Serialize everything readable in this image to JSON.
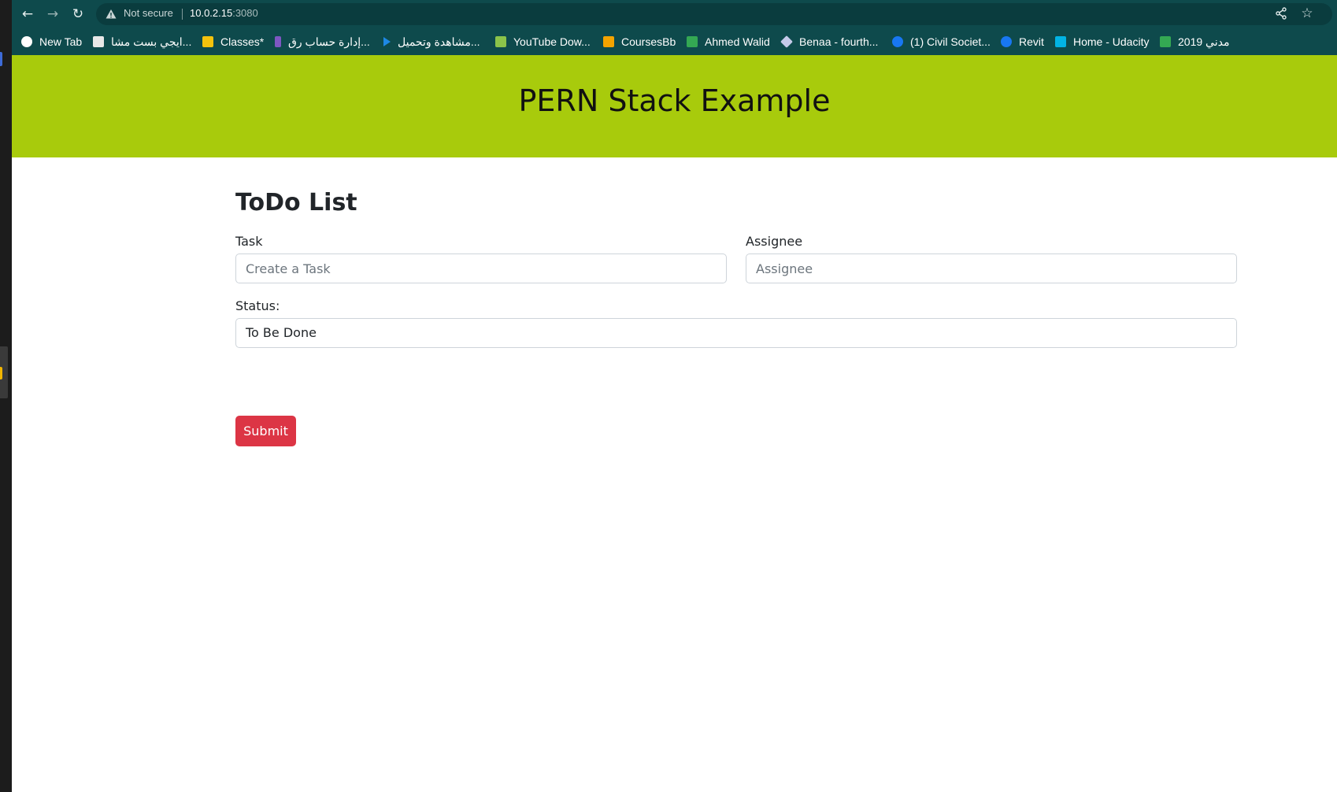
{
  "browser": {
    "security_label": "Not secure",
    "url_host": "10.0.2.15",
    "url_port": ":3080",
    "back_icon": "arrow-left-icon",
    "forward_icon": "arrow-right-icon",
    "reload_icon": "reload-icon",
    "share_icon": "share-icon",
    "bookmark_star_icon": "star-icon",
    "chrome_color": "#0e4a4c"
  },
  "bookmarks": [
    {
      "label": "New Tab",
      "icon_color": "#ffffff"
    },
    {
      "label": "ايجي بست مشا...",
      "icon_color": "#e8e8e8"
    },
    {
      "label": "Classes*",
      "icon_color": "#f4c20d"
    },
    {
      "label": "إدارة حساب رق...",
      "icon_color": "#7e57c2"
    },
    {
      "label": "مشاهدة وتحميل...",
      "icon_color": "#1e88e5"
    },
    {
      "label": "YouTube Dow...",
      "icon_color": "#8bc34a"
    },
    {
      "label": "CoursesBb",
      "icon_color": "#f4a300"
    },
    {
      "label": "Ahmed Walid",
      "icon_color": "#34a853"
    },
    {
      "label": "Benaa - fourth...",
      "icon_color": "#c5cae9"
    },
    {
      "label": "(1) Civil Societ...",
      "icon_color": "#1877f2"
    },
    {
      "label": "Revit",
      "icon_color": "#1877f2"
    },
    {
      "label": "Home - Udacity",
      "icon_color": "#02b3e4"
    },
    {
      "label": "مدني 2019",
      "icon_color": "#34a853"
    }
  ],
  "header": {
    "title": "PERN Stack Example",
    "background": "#a8cb0c"
  },
  "form": {
    "title": "ToDo List",
    "task_label": "Task",
    "task_placeholder": "Create a Task",
    "assignee_label": "Assignee",
    "assignee_placeholder": "Assignee",
    "status_label": "Status:",
    "status_value": "To Be Done",
    "submit_label": "Submit",
    "submit_color": "#dc3545"
  }
}
